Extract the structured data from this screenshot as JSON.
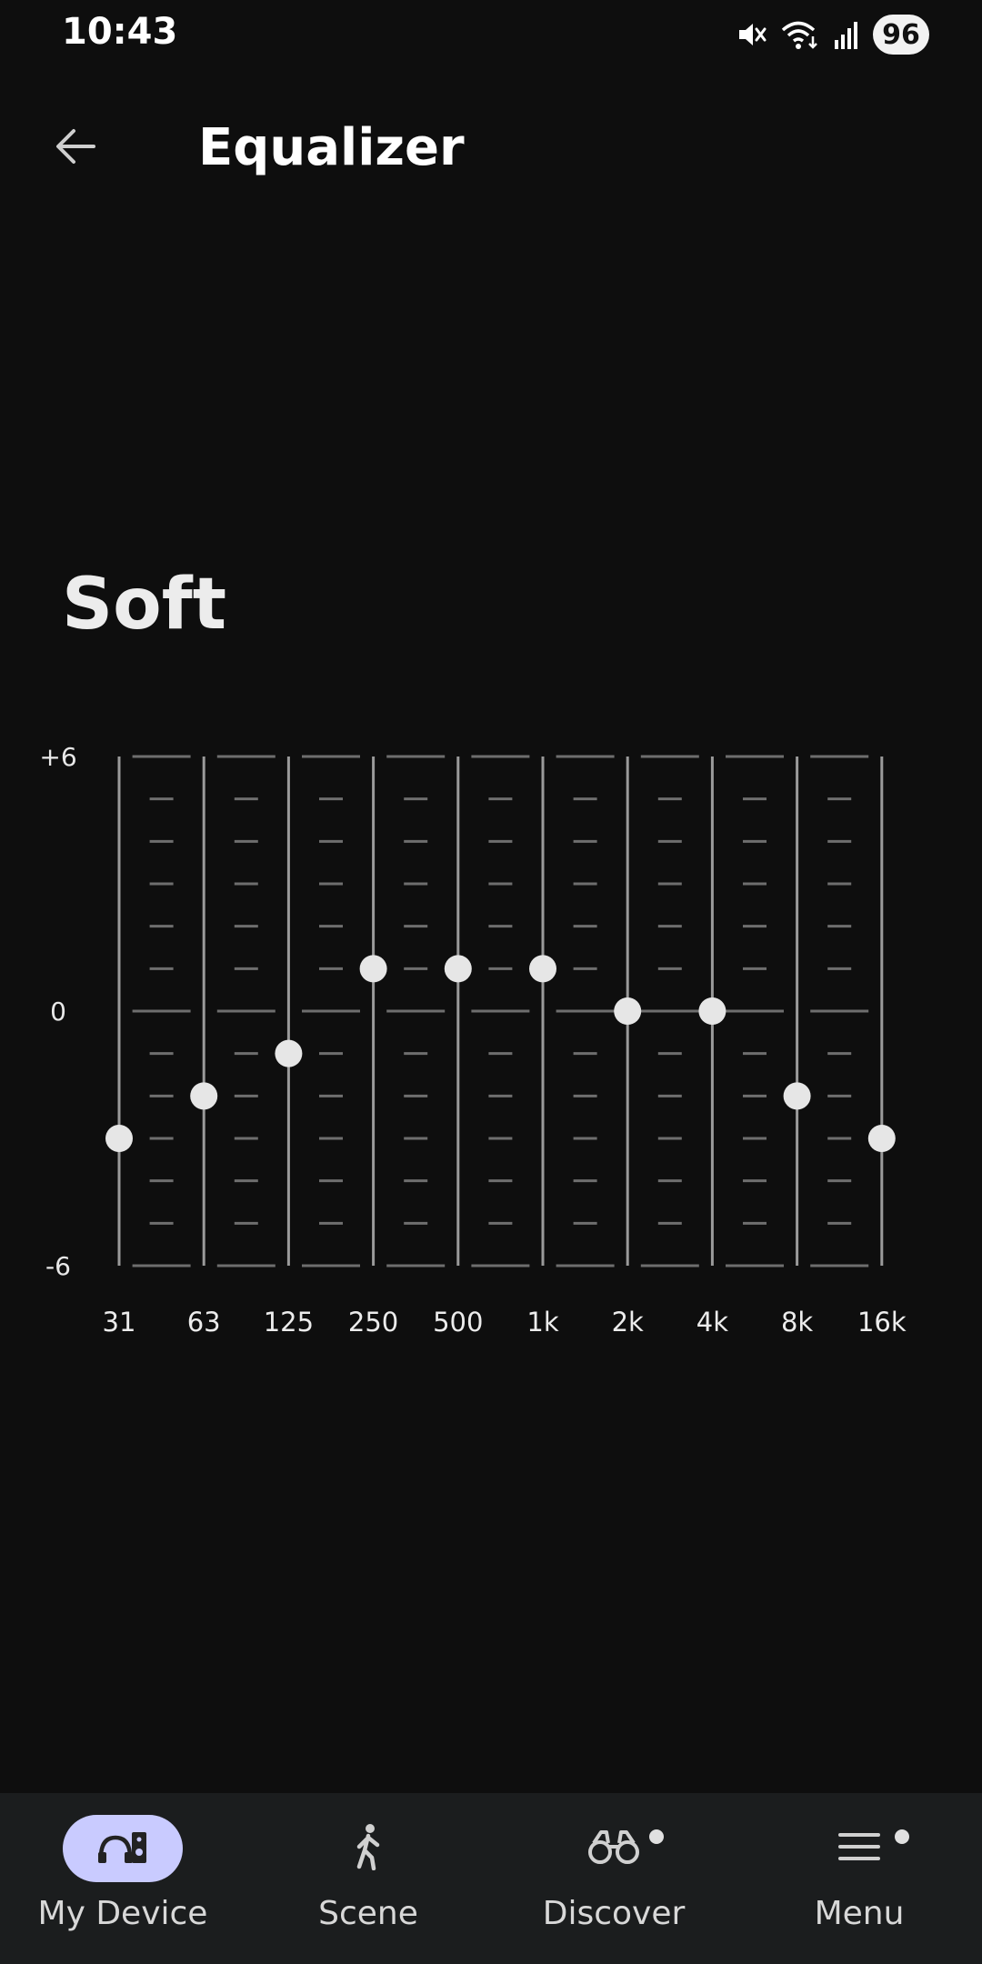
{
  "status_bar": {
    "time": "10:43",
    "battery": "96",
    "icons": [
      "mute-icon",
      "wifi-icon",
      "signal-icon"
    ]
  },
  "header": {
    "back_icon": "arrow-left-icon",
    "title": "Equalizer"
  },
  "preset": {
    "name": "Soft"
  },
  "equalizer": {
    "scale_labels": {
      "top": "+6",
      "mid": "0",
      "bottom": "-6"
    },
    "range": [
      -6,
      6
    ],
    "bands": [
      {
        "label": "31",
        "value": -3
      },
      {
        "label": "63",
        "value": -2
      },
      {
        "label": "125",
        "value": -1
      },
      {
        "label": "250",
        "value": 1
      },
      {
        "label": "500",
        "value": 1
      },
      {
        "label": "1k",
        "value": 1
      },
      {
        "label": "2k",
        "value": 0
      },
      {
        "label": "4k",
        "value": 0
      },
      {
        "label": "8k",
        "value": -2
      },
      {
        "label": "16k",
        "value": -3
      }
    ],
    "colors": {
      "track": "#9a9a9a",
      "tick": "#6e6e6e",
      "knob": "#e6e6e6"
    }
  },
  "bottom_nav": {
    "items": [
      {
        "label": "My Device",
        "icon": "device-icon",
        "active": true
      },
      {
        "label": "Scene",
        "icon": "walking-person-icon",
        "active": false
      },
      {
        "label": "Discover",
        "icon": "binoculars-icon",
        "active": false,
        "badge": true
      },
      {
        "label": "Menu",
        "icon": "hamburger-menu-icon",
        "active": false,
        "badge": true
      }
    ],
    "colors": {
      "active_pill": "#c9cbff",
      "background": "#1b1d1e"
    }
  }
}
